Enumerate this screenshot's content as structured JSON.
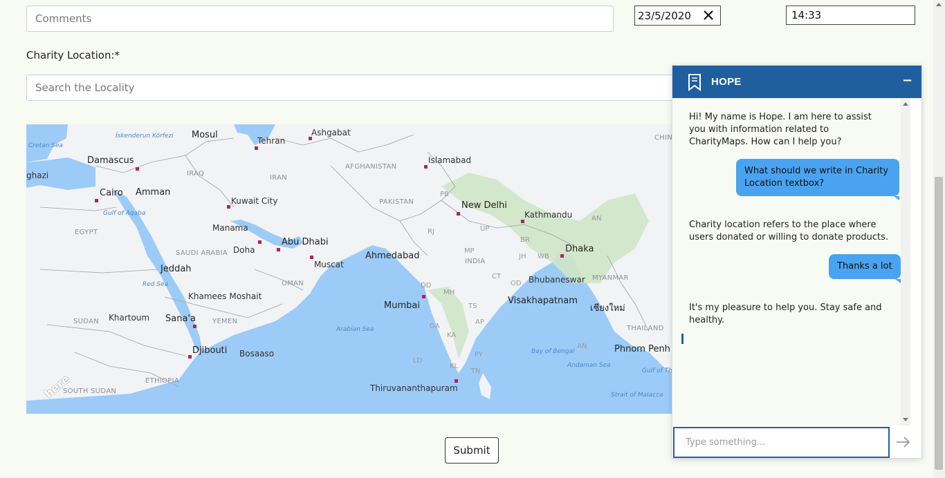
{
  "form": {
    "comments_placeholder": "Comments",
    "date_value": "23/5/2020",
    "time_value": "14:33",
    "location_label": "Charity Location:*",
    "locality_placeholder": "Search the Locality",
    "submit_label": "Submit"
  },
  "map": {
    "cities": [
      "Damascus",
      "Mosul",
      "Tehran",
      "Ashgabat",
      "Islamabad",
      "Amman",
      "Cairo",
      "Kuwait City",
      "Manama",
      "Doha",
      "Abu Dhabi",
      "Muscat",
      "New Delhi",
      "Kathmandu",
      "Dhaka",
      "Ahmedabad",
      "Jeddah",
      "Mumbai",
      "Bhubaneswar",
      "Visakhapatnam",
      "Khamees Moshait",
      "Khartoum",
      "Sana'a",
      "Djibouti",
      "Bosaaso",
      "Thiruvananthapuram",
      "Phnom Penh",
      "เชียงใหม่",
      "ghazi"
    ],
    "countries": [
      "IRAQ",
      "IRAN",
      "AFGHANISTAN",
      "PAKISTAN",
      "EGYPT",
      "SAUDI ARABIA",
      "OMAN",
      "INDIA",
      "YEMEN",
      "SUDAN",
      "ETHIOPIA",
      "SOUTH SUDAN",
      "MYANMAR",
      "THAILAND",
      "CHIN"
    ],
    "seas": [
      "Cretan Sea",
      "İskenderun Körfezi",
      "Gulf of Aqaba",
      "Red Sea",
      "Arabian Sea",
      "Bay of Bengal",
      "Andaman Sea",
      "Gulf of Thailand",
      "Strait of Malacca"
    ],
    "states": [
      "PB",
      "UP",
      "RJ",
      "BR",
      "JH",
      "WB",
      "MP",
      "DD",
      "CT",
      "OD",
      "MH",
      "TS",
      "AP",
      "GA",
      "KA",
      "KL",
      "TN",
      "PY",
      "LD",
      "AR",
      "AN"
    ],
    "logo_text": "here"
  },
  "chat": {
    "title": "HOPE",
    "minimize_label": "−",
    "messages": [
      {
        "from": "bot",
        "text": "Hi! My name is Hope. I am here to assist you with information related to CharityMaps. How can I help you?"
      },
      {
        "from": "user",
        "text": "What should we write in Charity Location textbox?"
      },
      {
        "from": "bot",
        "text": "Charity location refers to the place where users donated or willing to donate products."
      },
      {
        "from": "user",
        "text": "Thanks a lot"
      },
      {
        "from": "bot",
        "text": "It's my pleasure to help you. Stay safe and healthy."
      }
    ],
    "input_placeholder": "Type something...",
    "header_color": "#1f5f9f",
    "bubble_color": "#4aa3f0"
  }
}
